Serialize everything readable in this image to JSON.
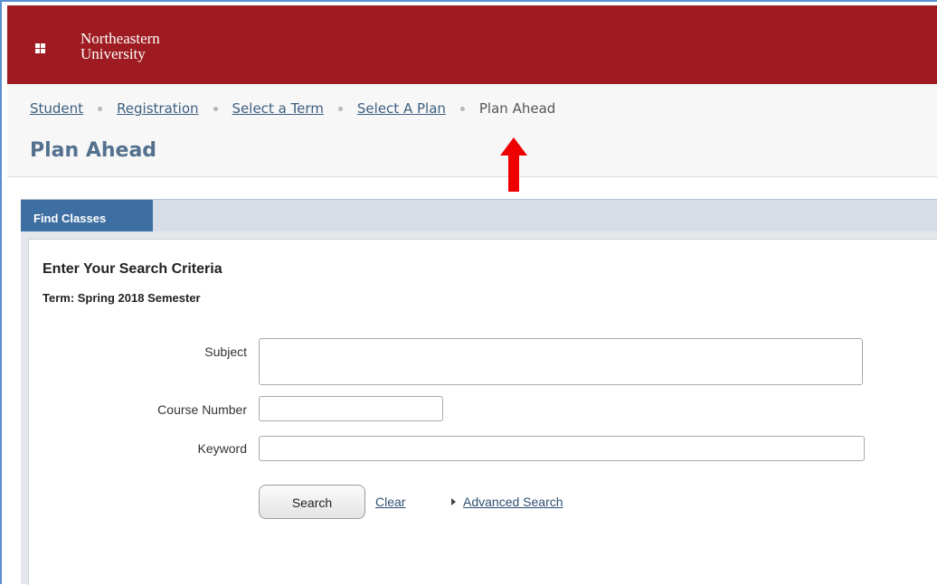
{
  "header": {
    "logo_line1": "Northeastern",
    "logo_line2": "University",
    "brand_color": "#9e1c21"
  },
  "breadcrumb": {
    "items": [
      {
        "label": "Student",
        "link": true
      },
      {
        "label": "Registration",
        "link": true
      },
      {
        "label": "Select a Term",
        "link": true
      },
      {
        "label": "Select A Plan",
        "link": true
      },
      {
        "label": "Plan Ahead",
        "link": false
      }
    ]
  },
  "page": {
    "title": "Plan Ahead"
  },
  "tabs": {
    "active": "Find Classes"
  },
  "form": {
    "heading": "Enter Your Search Criteria",
    "term": "Term: Spring 2018 Semester",
    "subject_label": "Subject",
    "subject_value": "",
    "course_number_label": "Course Number",
    "course_number_value": "",
    "keyword_label": "Keyword",
    "keyword_value": "",
    "search_button": "Search",
    "clear_link": "Clear",
    "advanced_link": "Advanced Search"
  },
  "annotation": {
    "arrow_color": "#ee0000"
  }
}
